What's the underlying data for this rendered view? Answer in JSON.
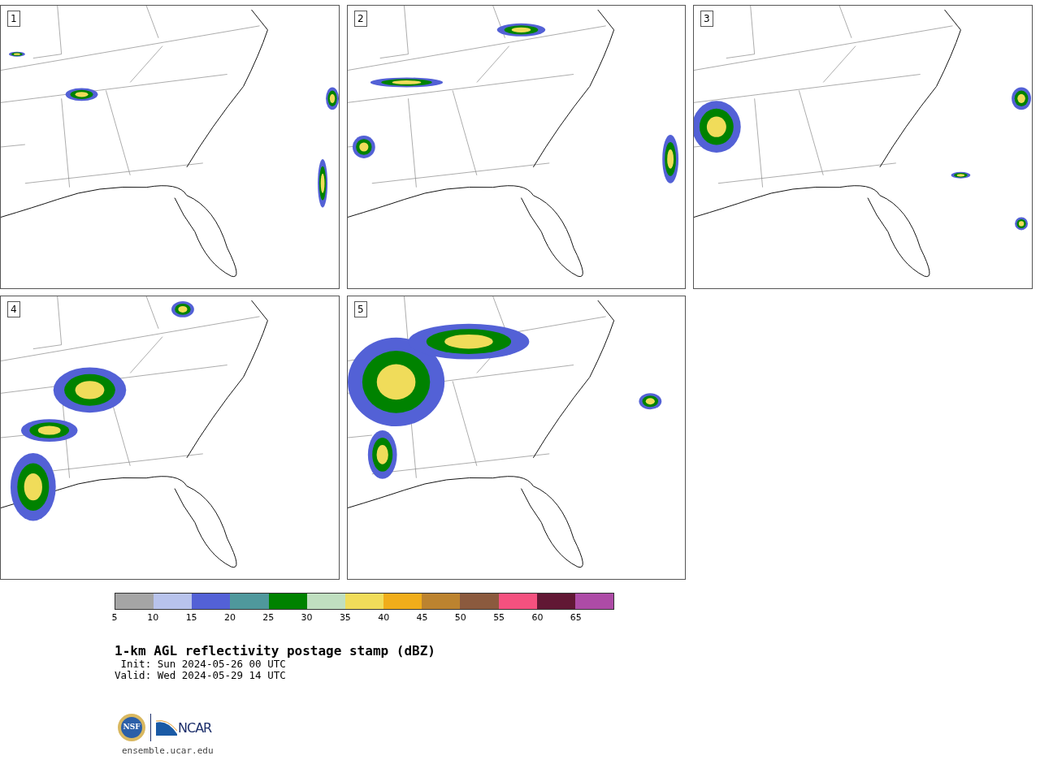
{
  "panels": [
    {
      "label": "1"
    },
    {
      "label": "2"
    },
    {
      "label": "3"
    },
    {
      "label": "4"
    },
    {
      "label": "5"
    }
  ],
  "colorbar": {
    "bins": [
      {
        "color": "#a5a5a5",
        "label": "5"
      },
      {
        "color": "#b8c3ec",
        "label": "10"
      },
      {
        "color": "#5361d6",
        "label": "15"
      },
      {
        "color": "#4f989c",
        "label": "20"
      },
      {
        "color": "#008200",
        "label": "25"
      },
      {
        "color": "#c0dfc0",
        "label": "30"
      },
      {
        "color": "#f0dc5a",
        "label": "35"
      },
      {
        "color": "#f0ad1a",
        "label": "40"
      },
      {
        "color": "#bc832f",
        "label": "45"
      },
      {
        "color": "#8b5a3e",
        "label": "50"
      },
      {
        "color": "#f4517f",
        "label": "55"
      },
      {
        "color": "#611734",
        "label": "60"
      },
      {
        "color": "#ad4ba6",
        "label": "65"
      }
    ]
  },
  "title": "1-km AGL reflectivity postage stamp (dBZ)",
  "init": " Init: Sun 2024-05-26 00 UTC",
  "valid": "Valid: Wed 2024-05-29 14 UTC",
  "logo": {
    "seal_text": "NSF",
    "org_text": "NCAR"
  },
  "site": "ensemble.ucar.edu"
}
